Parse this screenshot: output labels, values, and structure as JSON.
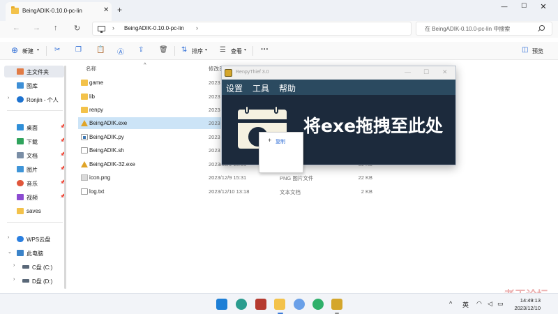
{
  "explorer": {
    "tab_title": "BeingADIK-0.10.0-pc-lin",
    "tab_close": "✕",
    "new_tab": "+",
    "window_buttons": {
      "minimize": "—",
      "maximize": "☐",
      "close": "✕"
    },
    "nav": {
      "back": "←",
      "forward": "→",
      "up": "↑",
      "refresh": "↻"
    },
    "address_path": "BeingADIK-0.10.0-pc-lin",
    "search_placeholder": "在 BeingADIK-0.10.0-pc-lin 中搜索",
    "commands": {
      "new": "新建",
      "sort": "排序",
      "view": "查看",
      "more": "···",
      "preview": "预览"
    },
    "sidebar": {
      "items": [
        {
          "label": "主文件夹",
          "icon": "home-icon"
        },
        {
          "label": "图库",
          "icon": "gallery-icon"
        },
        {
          "label": "Ronjin - 个人",
          "icon": "cloud-icon"
        },
        {
          "label": "桌面",
          "icon": "desktop-icon"
        },
        {
          "label": "下载",
          "icon": "download-icon"
        },
        {
          "label": "文档",
          "icon": "documents-icon"
        },
        {
          "label": "图片",
          "icon": "pictures-icon"
        },
        {
          "label": "音乐",
          "icon": "music-icon"
        },
        {
          "label": "视频",
          "icon": "videos-icon"
        },
        {
          "label": "saves",
          "icon": "folder-icon"
        },
        {
          "label": "WPS云盘",
          "icon": "cloud-icon"
        },
        {
          "label": "此电脑",
          "icon": "computer-icon"
        },
        {
          "label": "C盘 (C:)",
          "icon": "drive-icon"
        },
        {
          "label": "D盘 (D:)",
          "icon": "drive-icon"
        }
      ]
    },
    "columns": {
      "name": "名称",
      "modified": "修改日"
    },
    "files": [
      {
        "name": "game",
        "date": "2023",
        "type": "",
        "size": "",
        "kind": "folder"
      },
      {
        "name": "lib",
        "date": "2023",
        "type": "",
        "size": "",
        "kind": "folder"
      },
      {
        "name": "renpy",
        "date": "2023",
        "type": "",
        "size": "",
        "kind": "folder"
      },
      {
        "name": "BeingADIK.exe",
        "date": "2023",
        "type": "",
        "size": "",
        "kind": "exe"
      },
      {
        "name": "BeingADIK.py",
        "date": "2023",
        "type": "",
        "size": "",
        "kind": "py"
      },
      {
        "name": "BeingADIK.sh",
        "date": "2023",
        "type": "",
        "size": "",
        "kind": "file"
      },
      {
        "name": "BeingADIK-32.exe",
        "date": "2023/12/9 15:31",
        "type": "",
        "size": "39 KB",
        "kind": "exe"
      },
      {
        "name": "icon.png",
        "date": "2023/12/9 15:31",
        "type": "PNG 图片文件",
        "size": "22 KB",
        "kind": "png"
      },
      {
        "name": "log.txt",
        "date": "2023/12/10 13:18",
        "type": "文本文档",
        "size": "2 KB",
        "kind": "file"
      }
    ]
  },
  "renpy_window": {
    "title": "RenpyThief 3.0",
    "buttons": {
      "minimize": "—",
      "maximize": "☐",
      "close": "✕"
    },
    "menu": [
      "设置",
      "工具",
      "帮助"
    ],
    "drop_text": "将exe拖拽至此处"
  },
  "context_menu": {
    "items": [
      {
        "label": "复制",
        "icon": "+"
      }
    ]
  },
  "watermark": "老王论坛",
  "taskbar": {
    "tray": {
      "chevron": "^",
      "ime": "英"
    },
    "clock_time": "14:49:13",
    "clock_date": "2023/12/10"
  },
  "colors": {
    "accent": "#2b6bd6",
    "selection": "#cce4f7",
    "renpy_bg": "#1c2a3c",
    "renpy_menubar": "#2b4a60",
    "folder": "#f3c24a"
  }
}
